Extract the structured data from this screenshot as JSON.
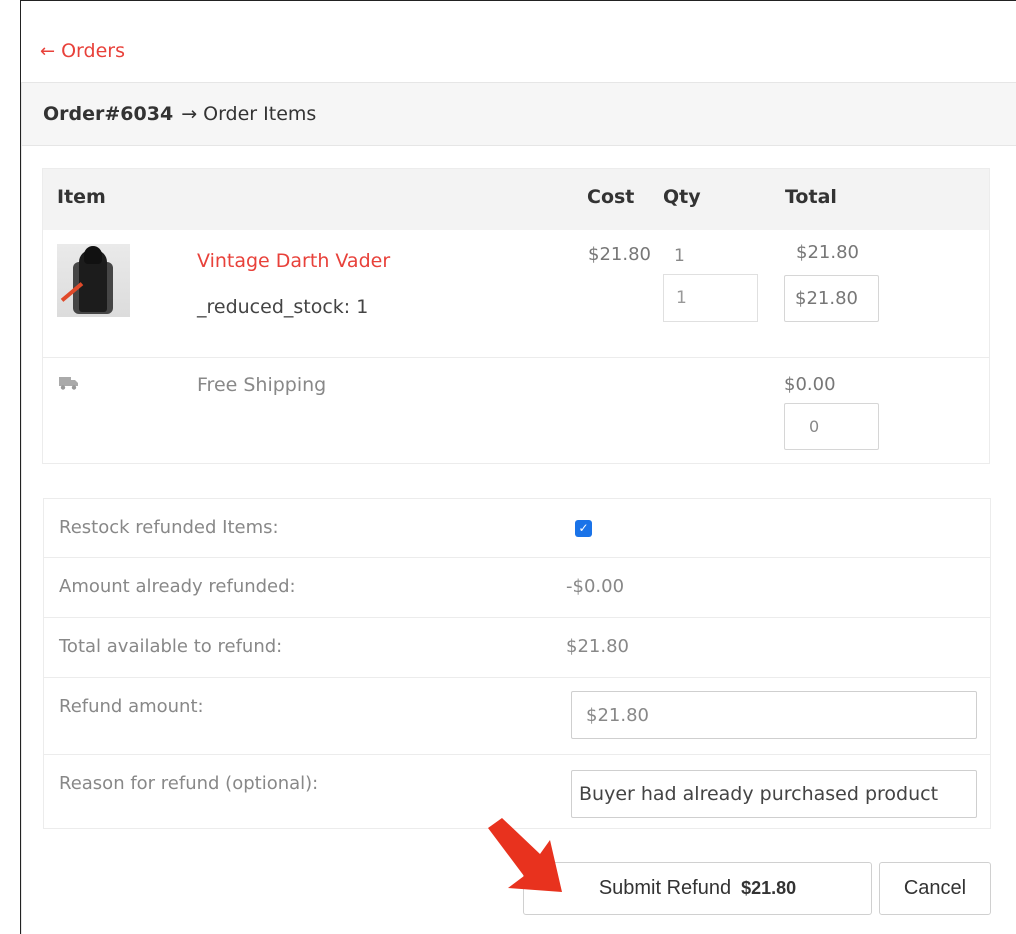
{
  "nav": {
    "back_label": "Orders",
    "back_arrow": "←"
  },
  "header": {
    "order_id": "Order#6034",
    "arrow": "→",
    "section": "Order Items"
  },
  "items_table": {
    "columns": {
      "item": "Item",
      "cost": "Cost",
      "qty": "Qty",
      "total": "Total"
    },
    "product": {
      "name": "Vintage Darth Vader",
      "meta": "_reduced_stock: 1",
      "cost": "$21.80",
      "qty": "1",
      "total": "$21.80",
      "qty_input_value": "1",
      "total_input_value": "$21.80"
    },
    "shipping": {
      "icon": "truck-icon",
      "name": "Free Shipping",
      "total": "$0.00",
      "input_value": "0"
    }
  },
  "refund_form": {
    "restock_label": "Restock refunded Items:",
    "restock_checked": true,
    "already_refunded_label": "Amount already refunded:",
    "already_refunded_value": "-$0.00",
    "available_label": "Total available to refund:",
    "available_value": "$21.80",
    "amount_label": "Refund amount:",
    "amount_value": "$21.80",
    "reason_label": "Reason for refund (optional):",
    "reason_value": "Buyer had already purchased product"
  },
  "actions": {
    "submit_label": "Submit Refund",
    "submit_amount": "$21.80",
    "cancel_label": "Cancel"
  },
  "colors": {
    "accent": "#e8413a",
    "checkbox": "#1a73e8",
    "arrow": "#e8321e"
  }
}
